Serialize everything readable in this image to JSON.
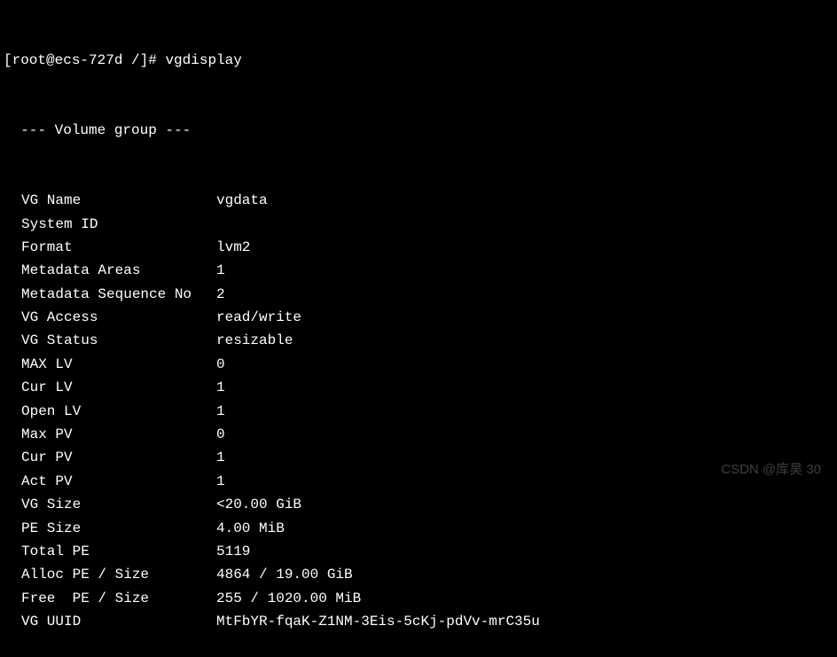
{
  "prompt": "[root@ecs-727d /]# ",
  "command": "vgdisplay",
  "header": "  --- Volume group ---",
  "rows": [
    {
      "label": "VG Name",
      "value": "vgdata"
    },
    {
      "label": "System ID",
      "value": ""
    },
    {
      "label": "Format",
      "value": "lvm2"
    },
    {
      "label": "Metadata Areas",
      "value": "1"
    },
    {
      "label": "Metadata Sequence No",
      "value": "2"
    },
    {
      "label": "VG Access",
      "value": "read/write"
    },
    {
      "label": "VG Status",
      "value": "resizable"
    },
    {
      "label": "MAX LV",
      "value": "0"
    },
    {
      "label": "Cur LV",
      "value": "1"
    },
    {
      "label": "Open LV",
      "value": "1"
    },
    {
      "label": "Max PV",
      "value": "0"
    },
    {
      "label": "Cur PV",
      "value": "1"
    },
    {
      "label": "Act PV",
      "value": "1"
    },
    {
      "label": "VG Size",
      "value": "<20.00 GiB"
    },
    {
      "label": "PE Size",
      "value": "4.00 MiB"
    },
    {
      "label": "Total PE",
      "value": "5119"
    },
    {
      "label": "Alloc PE / Size",
      "value": "4864 / 19.00 GiB"
    },
    {
      "label": "Free  PE / Size",
      "value": "255 / 1020.00 MiB"
    },
    {
      "label": "VG UUID",
      "value": "MtFbYR-fqaK-Z1NM-3Eis-5cKj-pdVv-mrC35u"
    }
  ],
  "watermark": "CSDN @库昊 30"
}
